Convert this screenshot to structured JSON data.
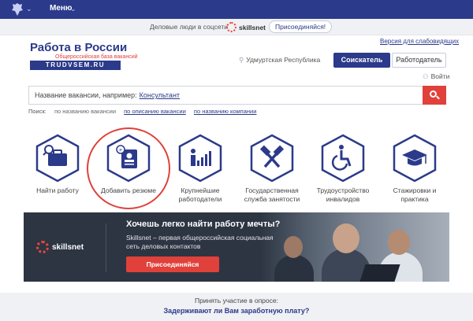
{
  "topbar": {
    "menu_label": "Меню"
  },
  "promo": {
    "text": "Деловые люди в соцсети",
    "brand": "skillsnet",
    "join_label": "Присоединяйся!"
  },
  "header": {
    "logo_title": "Работа в России",
    "logo_subtitle": "Общероссийская база вакансий",
    "logo_domain": "TRUDVSEM.RU",
    "version_link": "Версия для слабовидящих",
    "region": "Удмуртская Республика",
    "seeker_label": "Соискатель",
    "employer_label": "Работодатель",
    "login_label": "Войти"
  },
  "search": {
    "placeholder_prefix": "Название вакансии, например:",
    "placeholder_example": "Консультант",
    "mode_label": "Поиск:",
    "mode_name": "по названию вакансии",
    "mode_desc": "по описанию вакансии",
    "mode_company": "по названию компании"
  },
  "services": [
    {
      "label": "Найти работу",
      "icon": "briefcase-icon"
    },
    {
      "label": "Добавить резюме",
      "icon": "add-resume-icon"
    },
    {
      "label": "Крупнейшие работодатели",
      "icon": "bar-chart-icon"
    },
    {
      "label": "Государственная служба занятости",
      "icon": "hammers-icon"
    },
    {
      "label": "Трудоустройство инвалидов",
      "icon": "wheelchair-icon"
    },
    {
      "label": "Стажировки и практика",
      "icon": "graduation-cap-icon"
    }
  ],
  "banner": {
    "brand": "skillsnet",
    "title": "Хочешь легко найти работу мечты?",
    "text": "Skillsnet – первая общероссийская социальная сеть деловых контактов",
    "button_label": "Присоединяйся"
  },
  "poll": {
    "intro": "Принять участие в опросе:",
    "question": "Задерживают ли Вам заработную плату?"
  },
  "colors": {
    "brand": "#2b3a8a",
    "accent": "#e0413a"
  }
}
